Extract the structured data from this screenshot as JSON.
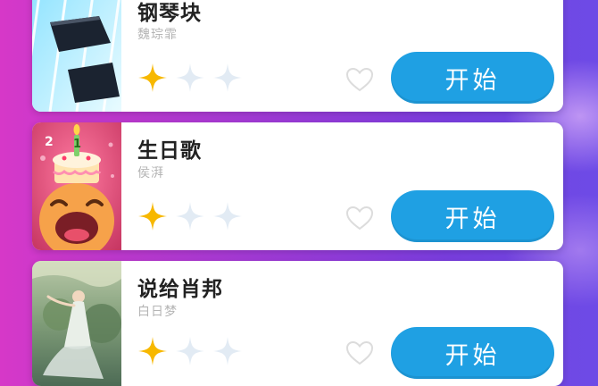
{
  "songs": [
    {
      "title": "钢琴块",
      "artist": "魏琮霏",
      "rating": 1,
      "max_rating": 3,
      "favorited": false,
      "button_label": "开始"
    },
    {
      "title": "生日歌",
      "artist": "侯湃",
      "rating": 1,
      "max_rating": 3,
      "favorited": false,
      "button_label": "开始"
    },
    {
      "title": "说给肖邦",
      "artist": "白日梦",
      "rating": 1,
      "max_rating": 3,
      "favorited": false,
      "button_label": "开始"
    }
  ],
  "cake_badge": {
    "left_number": "2",
    "candle_number": "1"
  },
  "colors": {
    "button": "#1fa0e3",
    "star_filled": "#f7b800",
    "star_empty": "#e2ebf4",
    "heart_outline": "#dcdcdc"
  },
  "icons": {
    "star": "star-icon",
    "empty_star": "empty-star-icon",
    "heart": "heart-icon"
  }
}
